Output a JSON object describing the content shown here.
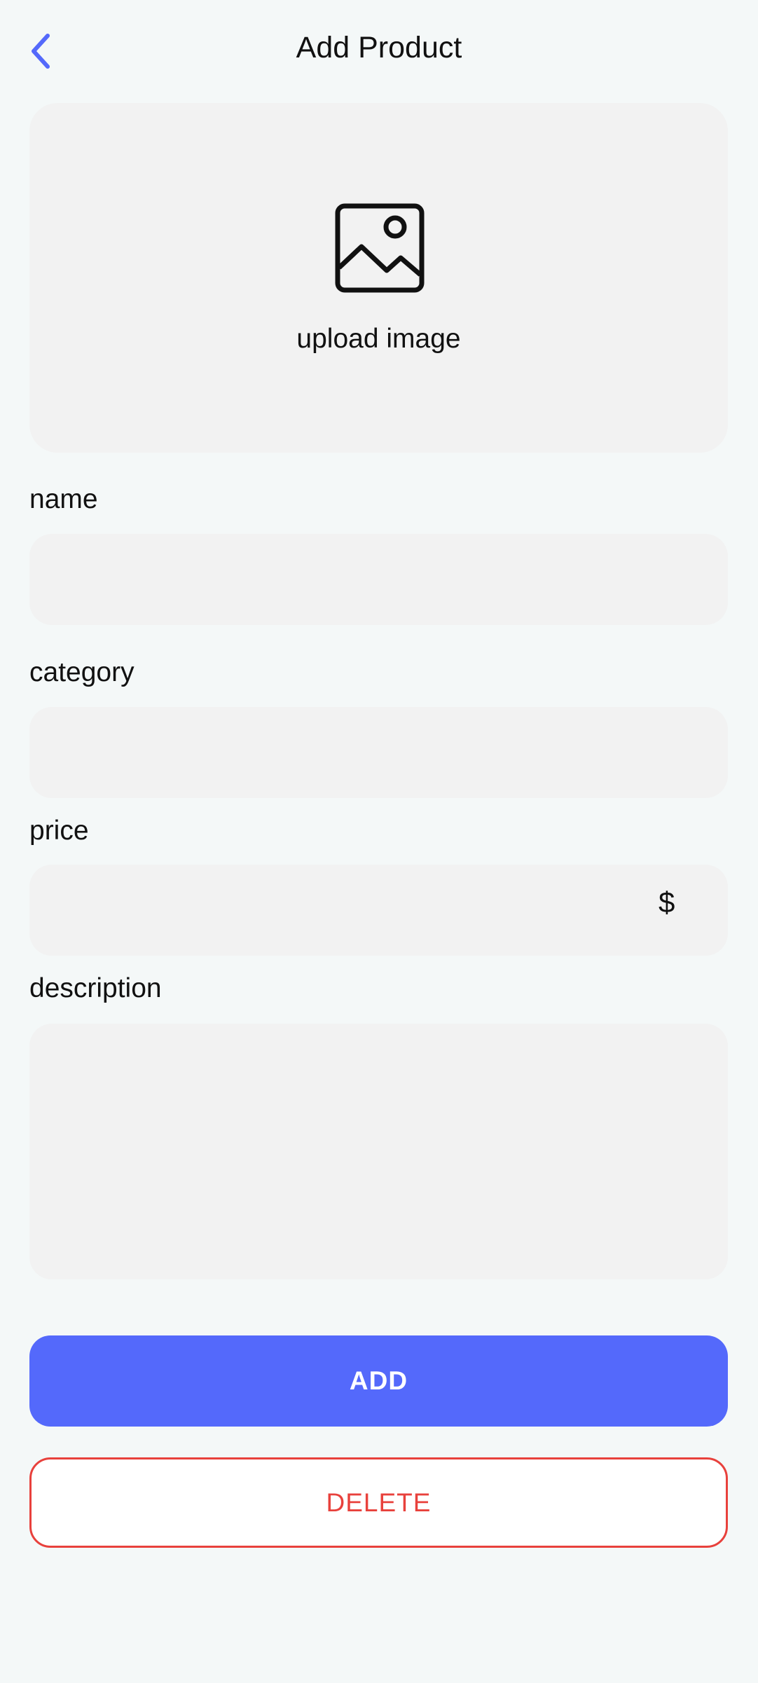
{
  "header": {
    "title": "Add Product",
    "back_icon": "chevron-left-icon"
  },
  "upload": {
    "icon": "image-icon",
    "label": "upload image"
  },
  "form": {
    "name": {
      "label": "name",
      "value": "",
      "placeholder": ""
    },
    "category": {
      "label": "category",
      "value": "",
      "placeholder": ""
    },
    "price": {
      "label": "price",
      "value": "",
      "placeholder": "",
      "suffix": "$"
    },
    "description": {
      "label": "description",
      "value": "",
      "placeholder": ""
    }
  },
  "actions": {
    "add_label": "ADD",
    "delete_label": "DELETE"
  },
  "colors": {
    "accent": "#5469fb",
    "danger": "#e8413c",
    "background": "#f4f8f8",
    "field": "#f2f2f2"
  }
}
